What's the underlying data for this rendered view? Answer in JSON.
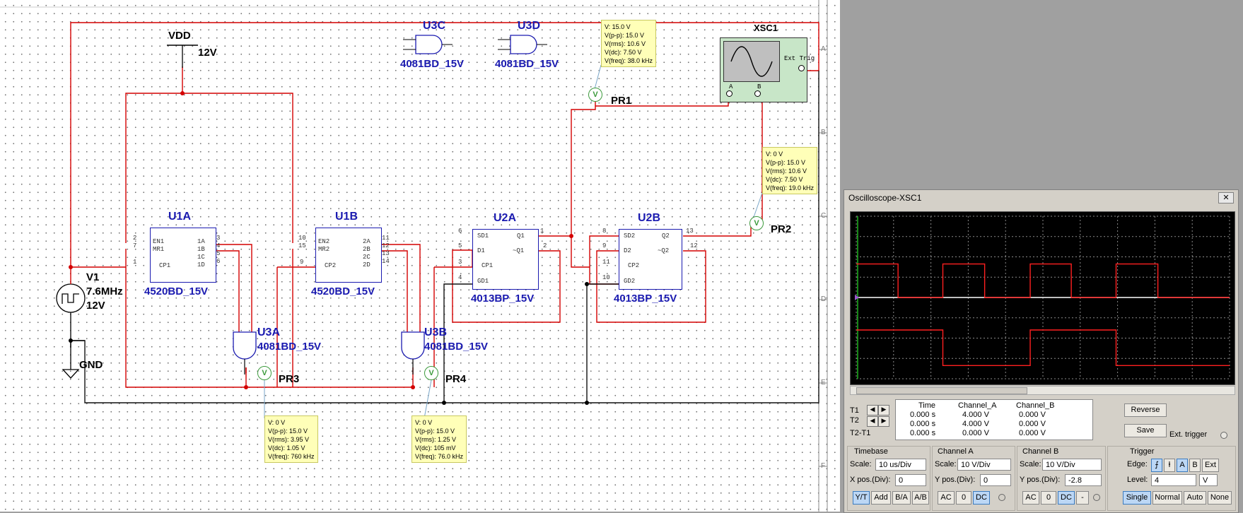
{
  "schematic": {
    "components": {
      "u1a": {
        "ref": "U1A",
        "part": "4520BD_15V",
        "pins_left": [
          "2",
          "7",
          "1"
        ],
        "pin_labels_left": [
          "EN1",
          "MR1",
          "CP1"
        ],
        "pins_right": [
          "3",
          "4",
          "5",
          "6"
        ],
        "pin_labels_right": [
          "1A",
          "1B",
          "1C",
          "1D"
        ]
      },
      "u1b": {
        "ref": "U1B",
        "part": "4520BD_15V",
        "pins_left": [
          "10",
          "15",
          "9"
        ],
        "pin_labels_left": [
          "EN2",
          "MR2",
          "CP2"
        ],
        "pins_right": [
          "11",
          "12",
          "13",
          "14"
        ],
        "pin_labels_right": [
          "2A",
          "2B",
          "2C",
          "2D"
        ]
      },
      "u2a": {
        "ref": "U2A",
        "part": "4013BP_15V",
        "pins_left": [
          "6",
          "5",
          "3",
          "4"
        ],
        "pin_labels_left": [
          "SD1",
          "D1",
          "CP1",
          "GD1"
        ],
        "pins_right": [
          "1",
          "2"
        ],
        "pin_labels_right": [
          "Q1",
          "~Q1"
        ]
      },
      "u2b": {
        "ref": "U2B",
        "part": "4013BP_15V",
        "pins_left": [
          "8",
          "9",
          "11",
          "10"
        ],
        "pin_labels_left": [
          "SD2",
          "D2",
          "CP2",
          "GD2"
        ],
        "pins_right": [
          "13",
          "12"
        ],
        "pin_labels_right": [
          "Q2",
          "~Q2"
        ]
      },
      "u3a": {
        "ref": "U3A",
        "part": "4081BD_15V"
      },
      "u3b": {
        "ref": "U3B",
        "part": "4081BD_15V"
      },
      "u3c": {
        "ref": "U3C",
        "part": "4081BD_15V"
      },
      "u3d": {
        "ref": "U3D",
        "part": "4081BD_15V"
      },
      "v1": {
        "ref": "V1",
        "freq": "7.6MHz",
        "amp": "12V"
      },
      "vdd": {
        "ref": "VDD",
        "value": "12V"
      },
      "gnd": {
        "ref": "GND"
      },
      "xsc1": {
        "ref": "XSC1",
        "ch_a": "A",
        "ch_b": "B",
        "ext": "Ext Trig"
      }
    },
    "probes": {
      "pr1": {
        "ref": "PR1",
        "symbol": "V",
        "readings": [
          "V: 15.0 V",
          "V(p-p): 15.0 V",
          "V(rms): 10.6 V",
          "V(dc): 7.50 V",
          "V(freq): 38.0 kHz"
        ]
      },
      "pr2": {
        "ref": "PR2",
        "symbol": "V",
        "readings": [
          "V: 0 V",
          "V(p-p): 15.0 V",
          "V(rms): 10.6 V",
          "V(dc): 7.50 V",
          "V(freq): 19.0 kHz"
        ]
      },
      "pr3": {
        "ref": "PR3",
        "symbol": "V",
        "readings": [
          "V: 0 V",
          "V(p-p): 15.0 V",
          "V(rms): 3.95 V",
          "V(dc): 1.05 V",
          "V(freq): 760 kHz"
        ]
      },
      "pr4": {
        "ref": "PR4",
        "symbol": "V",
        "readings": [
          "V: 0 V",
          "V(p-p): 15.0 V",
          "V(rms): 1.25 V",
          "V(dc): 105 mV",
          "V(freq): 76.0 kHz"
        ]
      }
    },
    "border_marks": {
      "right": [
        "A",
        "B",
        "C",
        "D",
        "E",
        "F"
      ]
    }
  },
  "oscilloscope": {
    "title": "Oscilloscope-XSC1",
    "close": "✕",
    "colors": {
      "trace_a": "#ff2020",
      "trace_b": "#ff2020",
      "grid": "#8a8a8a",
      "screen": "#000000"
    },
    "readout": {
      "headers": [
        "Time",
        "Channel_A",
        "Channel_B"
      ],
      "rows": [
        {
          "label": "T1",
          "time": "0.000 s",
          "a": "4.000 V",
          "b": "0.000 V"
        },
        {
          "label": "T2",
          "time": "0.000 s",
          "a": "4.000 V",
          "b": "0.000 V"
        },
        {
          "label": "T2-T1",
          "time": "0.000 s",
          "a": "0.000 V",
          "b": "0.000 V"
        }
      ]
    },
    "buttons": {
      "reverse": "Reverse",
      "save": "Save",
      "ext_trigger": "Ext. trigger"
    },
    "timebase": {
      "title": "Timebase",
      "scale_label": "Scale:",
      "scale": "10 us/Div",
      "xpos_label": "X pos.(Div):",
      "xpos": "0",
      "modes": [
        "Y/T",
        "Add",
        "B/A",
        "A/B"
      ]
    },
    "channel_a": {
      "title": "Channel A",
      "scale_label": "Scale:",
      "scale": "10  V/Div",
      "ypos_label": "Y pos.(Div):",
      "ypos": "0",
      "coupling": [
        "AC",
        "0",
        "DC"
      ]
    },
    "channel_b": {
      "title": "Channel B",
      "scale_label": "Scale:",
      "scale": "10  V/Div",
      "ypos_label": "Y pos.(Div):",
      "ypos": "-2.8",
      "coupling": [
        "AC",
        "0",
        "DC",
        "-"
      ]
    },
    "trigger": {
      "title": "Trigger",
      "edge_label": "Edge:",
      "edges": [
        "A",
        "B",
        "Ext"
      ],
      "level_label": "Level:",
      "level": "4",
      "level_unit": "V",
      "modes": [
        "Single",
        "Normal",
        "Auto",
        "None"
      ]
    }
  }
}
